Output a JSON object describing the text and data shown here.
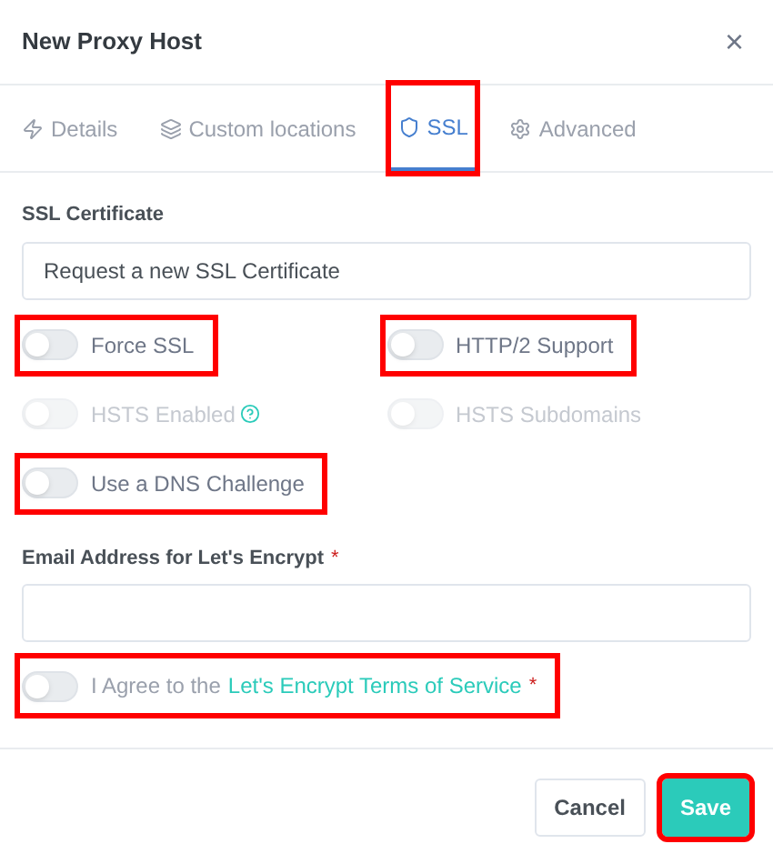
{
  "dialog": {
    "title": "New Proxy Host",
    "close": "×"
  },
  "tabs": [
    {
      "label": "Details",
      "selected": false,
      "highlighted": false
    },
    {
      "label": "Custom locations",
      "selected": false,
      "highlighted": false
    },
    {
      "label": "SSL",
      "selected": true,
      "highlighted": true
    },
    {
      "label": "Advanced",
      "selected": false,
      "highlighted": false
    }
  ],
  "ssl_certificate": {
    "label": "SSL Certificate",
    "value": "Request a new SSL Certificate"
  },
  "toggles": [
    {
      "label": "Force SSL",
      "on": false,
      "disabled": false,
      "help": false,
      "highlighted": true
    },
    {
      "label": "HTTP/2 Support",
      "on": false,
      "disabled": false,
      "help": false,
      "highlighted": true
    },
    {
      "label": "HSTS Enabled",
      "on": false,
      "disabled": true,
      "help": true,
      "highlighted": false
    },
    {
      "label": "HSTS Subdomains",
      "on": false,
      "disabled": true,
      "help": false,
      "highlighted": false
    },
    {
      "label": "Use a DNS Challenge",
      "on": false,
      "disabled": false,
      "help": false,
      "highlighted": true
    }
  ],
  "email": {
    "label": "Email Address for Let's Encrypt",
    "required_mark": "*"
  },
  "agree": {
    "prefix": "I Agree to the",
    "link": "Let's Encrypt Terms of Service",
    "required_mark": "*",
    "on": false,
    "highlighted": true
  },
  "buttons": [
    {
      "label": "Cancel",
      "kind": "secondary",
      "highlighted": false
    },
    {
      "label": "Save",
      "kind": "primary",
      "highlighted": true
    }
  ]
}
